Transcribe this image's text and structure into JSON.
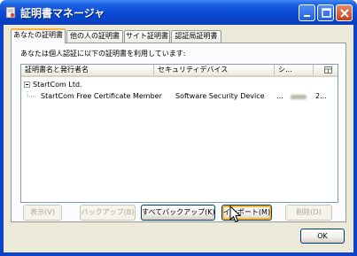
{
  "window": {
    "title": "証明書マネージャ"
  },
  "tabs": [
    {
      "label": "あなたの証明書",
      "active": true
    },
    {
      "label": "他の人の証明書",
      "active": false
    },
    {
      "label": "サイト証明書",
      "active": false
    },
    {
      "label": "認証局証明書",
      "active": false
    }
  ],
  "description": "あなたは個人認証に以下の証明書を利用しています:",
  "list": {
    "columns": [
      {
        "label": "証明書名と発行者名"
      },
      {
        "label": "セキュリティデバイス"
      },
      {
        "label": "シ..."
      },
      {
        "label": ""
      }
    ],
    "groups": [
      {
        "name": "StartCom Ltd.",
        "expanded": true,
        "items": [
          {
            "name": "StartCom Free Certificate Member",
            "device": "Software Security Device",
            "serial": "...",
            "expires": "2..."
          }
        ]
      }
    ]
  },
  "buttons": {
    "view": "表示(V)",
    "backup": "バックアップ(B)",
    "backup_all": "すべてバックアップ(K)",
    "import": "インポート(M)",
    "delete": "削除(D)",
    "ok": "OK"
  },
  "colors": {
    "titlebar": "#0a49d4",
    "dialog_bg": "#ece9d8",
    "tab_highlight": "#f7b33c"
  }
}
